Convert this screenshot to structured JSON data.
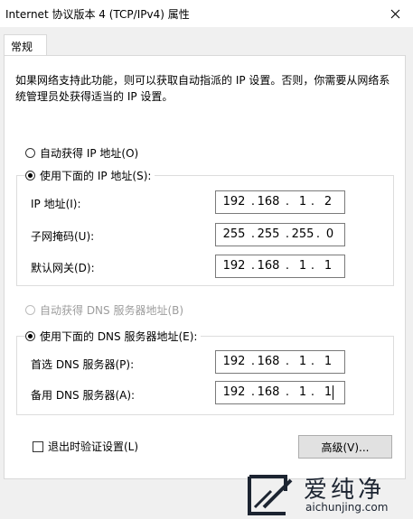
{
  "window": {
    "title": "Internet 协议版本 4 (TCP/IPv4) 属性"
  },
  "tab": {
    "label": "常规"
  },
  "description": "如果网络支持此功能，则可以获取自动指派的 IP 设置。否则，你需要从网络系统管理员处获得适当的 IP 设置。",
  "ip_section": {
    "auto_label": "自动获得 IP 地址(O)",
    "manual_label": "使用下面的 IP 地址(S):",
    "mode": "manual",
    "fields": [
      {
        "label": "IP 地址(I):",
        "octets": [
          "192",
          "168",
          "1",
          "2"
        ]
      },
      {
        "label": "子网掩码(U):",
        "octets": [
          "255",
          "255",
          "255",
          "0"
        ]
      },
      {
        "label": "默认网关(D):",
        "octets": [
          "192",
          "168",
          "1",
          "1"
        ]
      }
    ]
  },
  "dns_section": {
    "auto_label": "自动获得 DNS 服务器地址(B)",
    "manual_label": "使用下面的 DNS 服务器地址(E):",
    "mode": "manual",
    "fields": [
      {
        "label": "首选 DNS 服务器(P):",
        "octets": [
          "192",
          "168",
          "1",
          "1"
        ]
      },
      {
        "label": "备用 DNS 服务器(A):",
        "octets": [
          "192",
          "168",
          "1",
          "1"
        ]
      }
    ]
  },
  "validate_label": "退出时验证设置(L)",
  "validate_checked": false,
  "advanced_label": "高级(V)...",
  "watermark": {
    "text": "爱纯净",
    "url": "aichunjing.com"
  },
  "colors": {
    "panel_bg": "#ffffff",
    "window_bg": "#f0f0f0",
    "border": "#7a7a7a",
    "disabled_text": "#9d9d9d"
  }
}
